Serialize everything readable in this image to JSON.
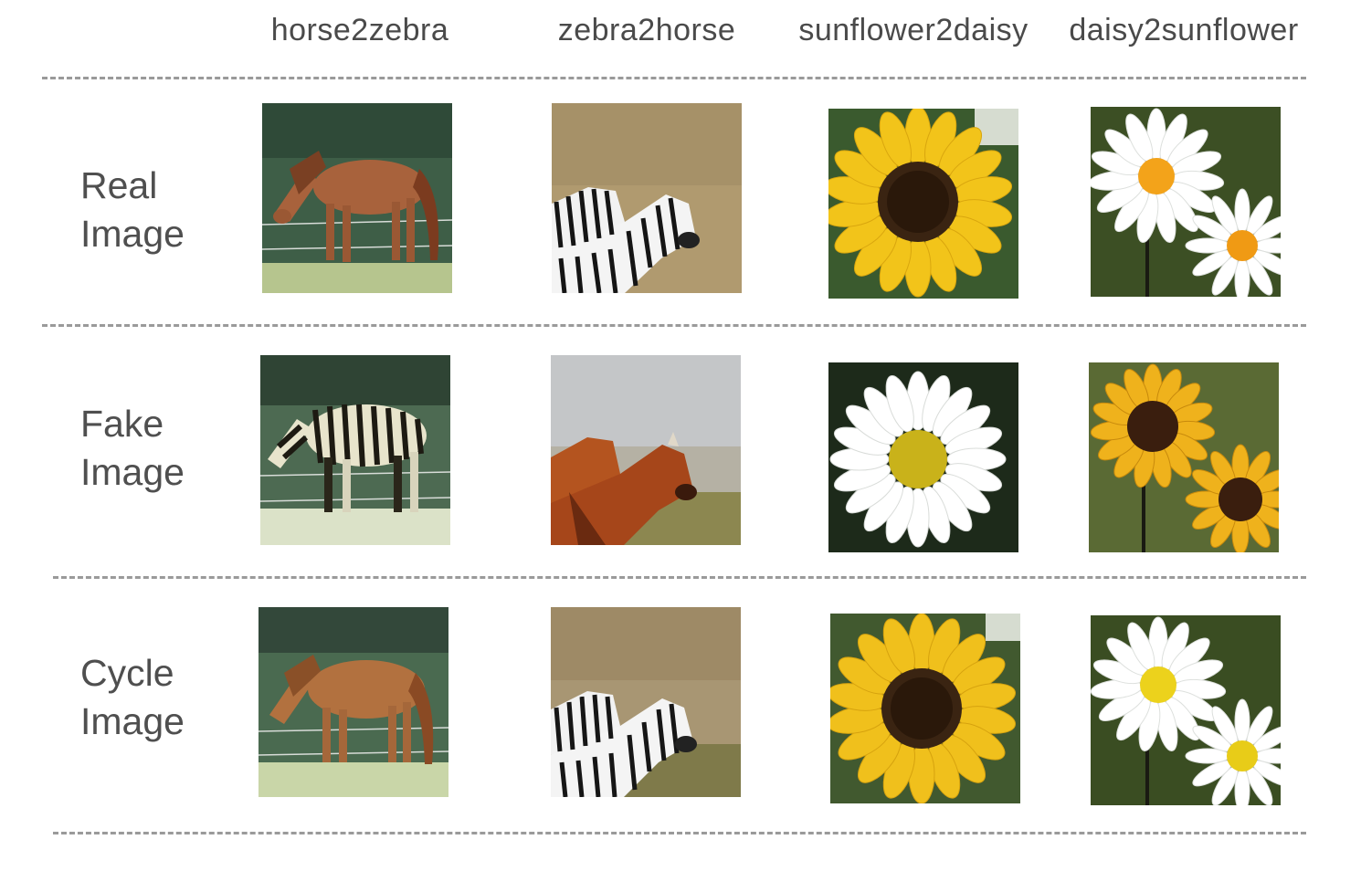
{
  "columns": [
    "horse2zebra",
    "zebra2horse",
    "sunflower2daisy",
    "daisy2sunflower"
  ],
  "rows": [
    {
      "line1": "Real",
      "line2": "Image",
      "cells": [
        "brown horse grazing by fence",
        "two zebras in dry grass",
        "yellow sunflower",
        "two white daisies"
      ]
    },
    {
      "line1": "Fake",
      "line2": "Image",
      "cells": [
        "zebra-striped horse by fence",
        "two brown horses in dry grass",
        "white daisy",
        "two yellow sunflowers"
      ]
    },
    {
      "line1": "Cycle",
      "line2": "Image",
      "cells": [
        "reconstructed brown horse",
        "reconstructed zebras",
        "reconstructed sunflower",
        "reconstructed daisies"
      ]
    }
  ]
}
